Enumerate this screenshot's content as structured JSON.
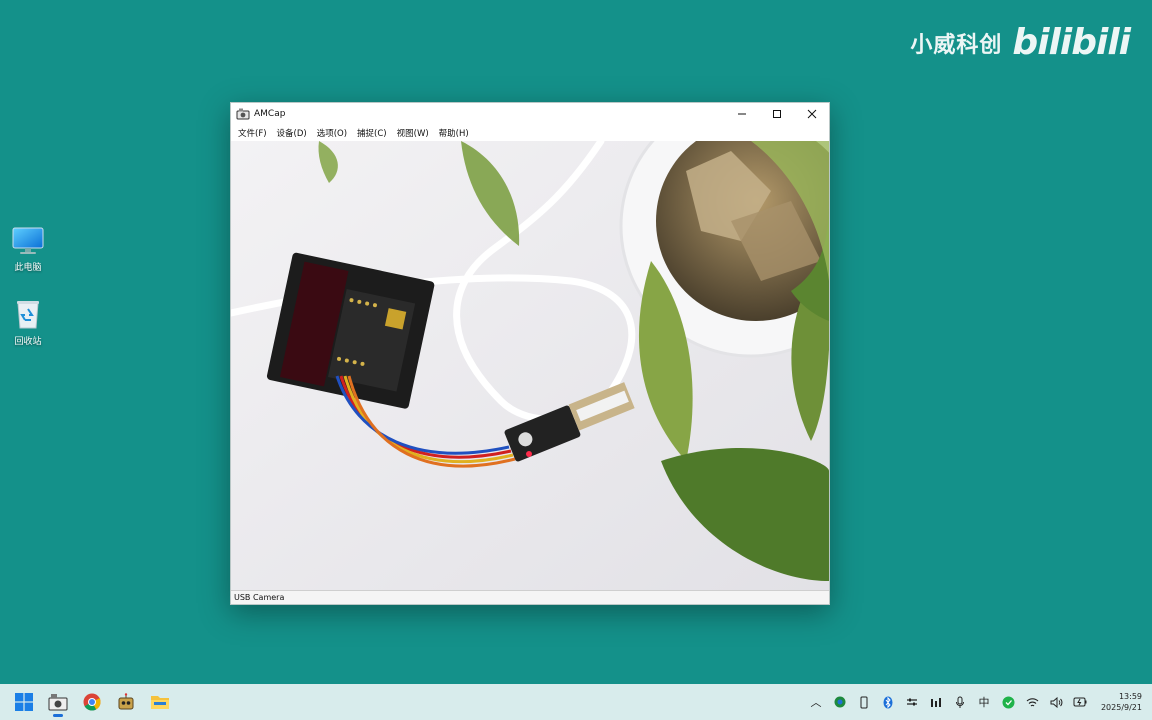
{
  "watermark": {
    "channel": "小威科创",
    "logo": "bilibili"
  },
  "desktop": {
    "icons": [
      {
        "label": "此电脑"
      },
      {
        "label": "回收站"
      }
    ]
  },
  "window": {
    "title": "AMCap",
    "menu": [
      "文件(F)",
      "设备(D)",
      "选项(O)",
      "捕捉(C)",
      "视图(W)",
      "帮助(H)"
    ],
    "status": "USB Camera"
  },
  "taskbar": {
    "apps": [
      "windows-start-icon",
      "amcap-icon",
      "chrome-icon",
      "robot-app-icon",
      "file-explorer-icon"
    ],
    "tray": {
      "chevron": "︿",
      "ime": "中",
      "time": "13:59",
      "date": "2025/9/21"
    }
  },
  "colors": {
    "desktop": "#14918a",
    "taskbar": "#d8ecec",
    "accent": "#1b6fd8"
  }
}
